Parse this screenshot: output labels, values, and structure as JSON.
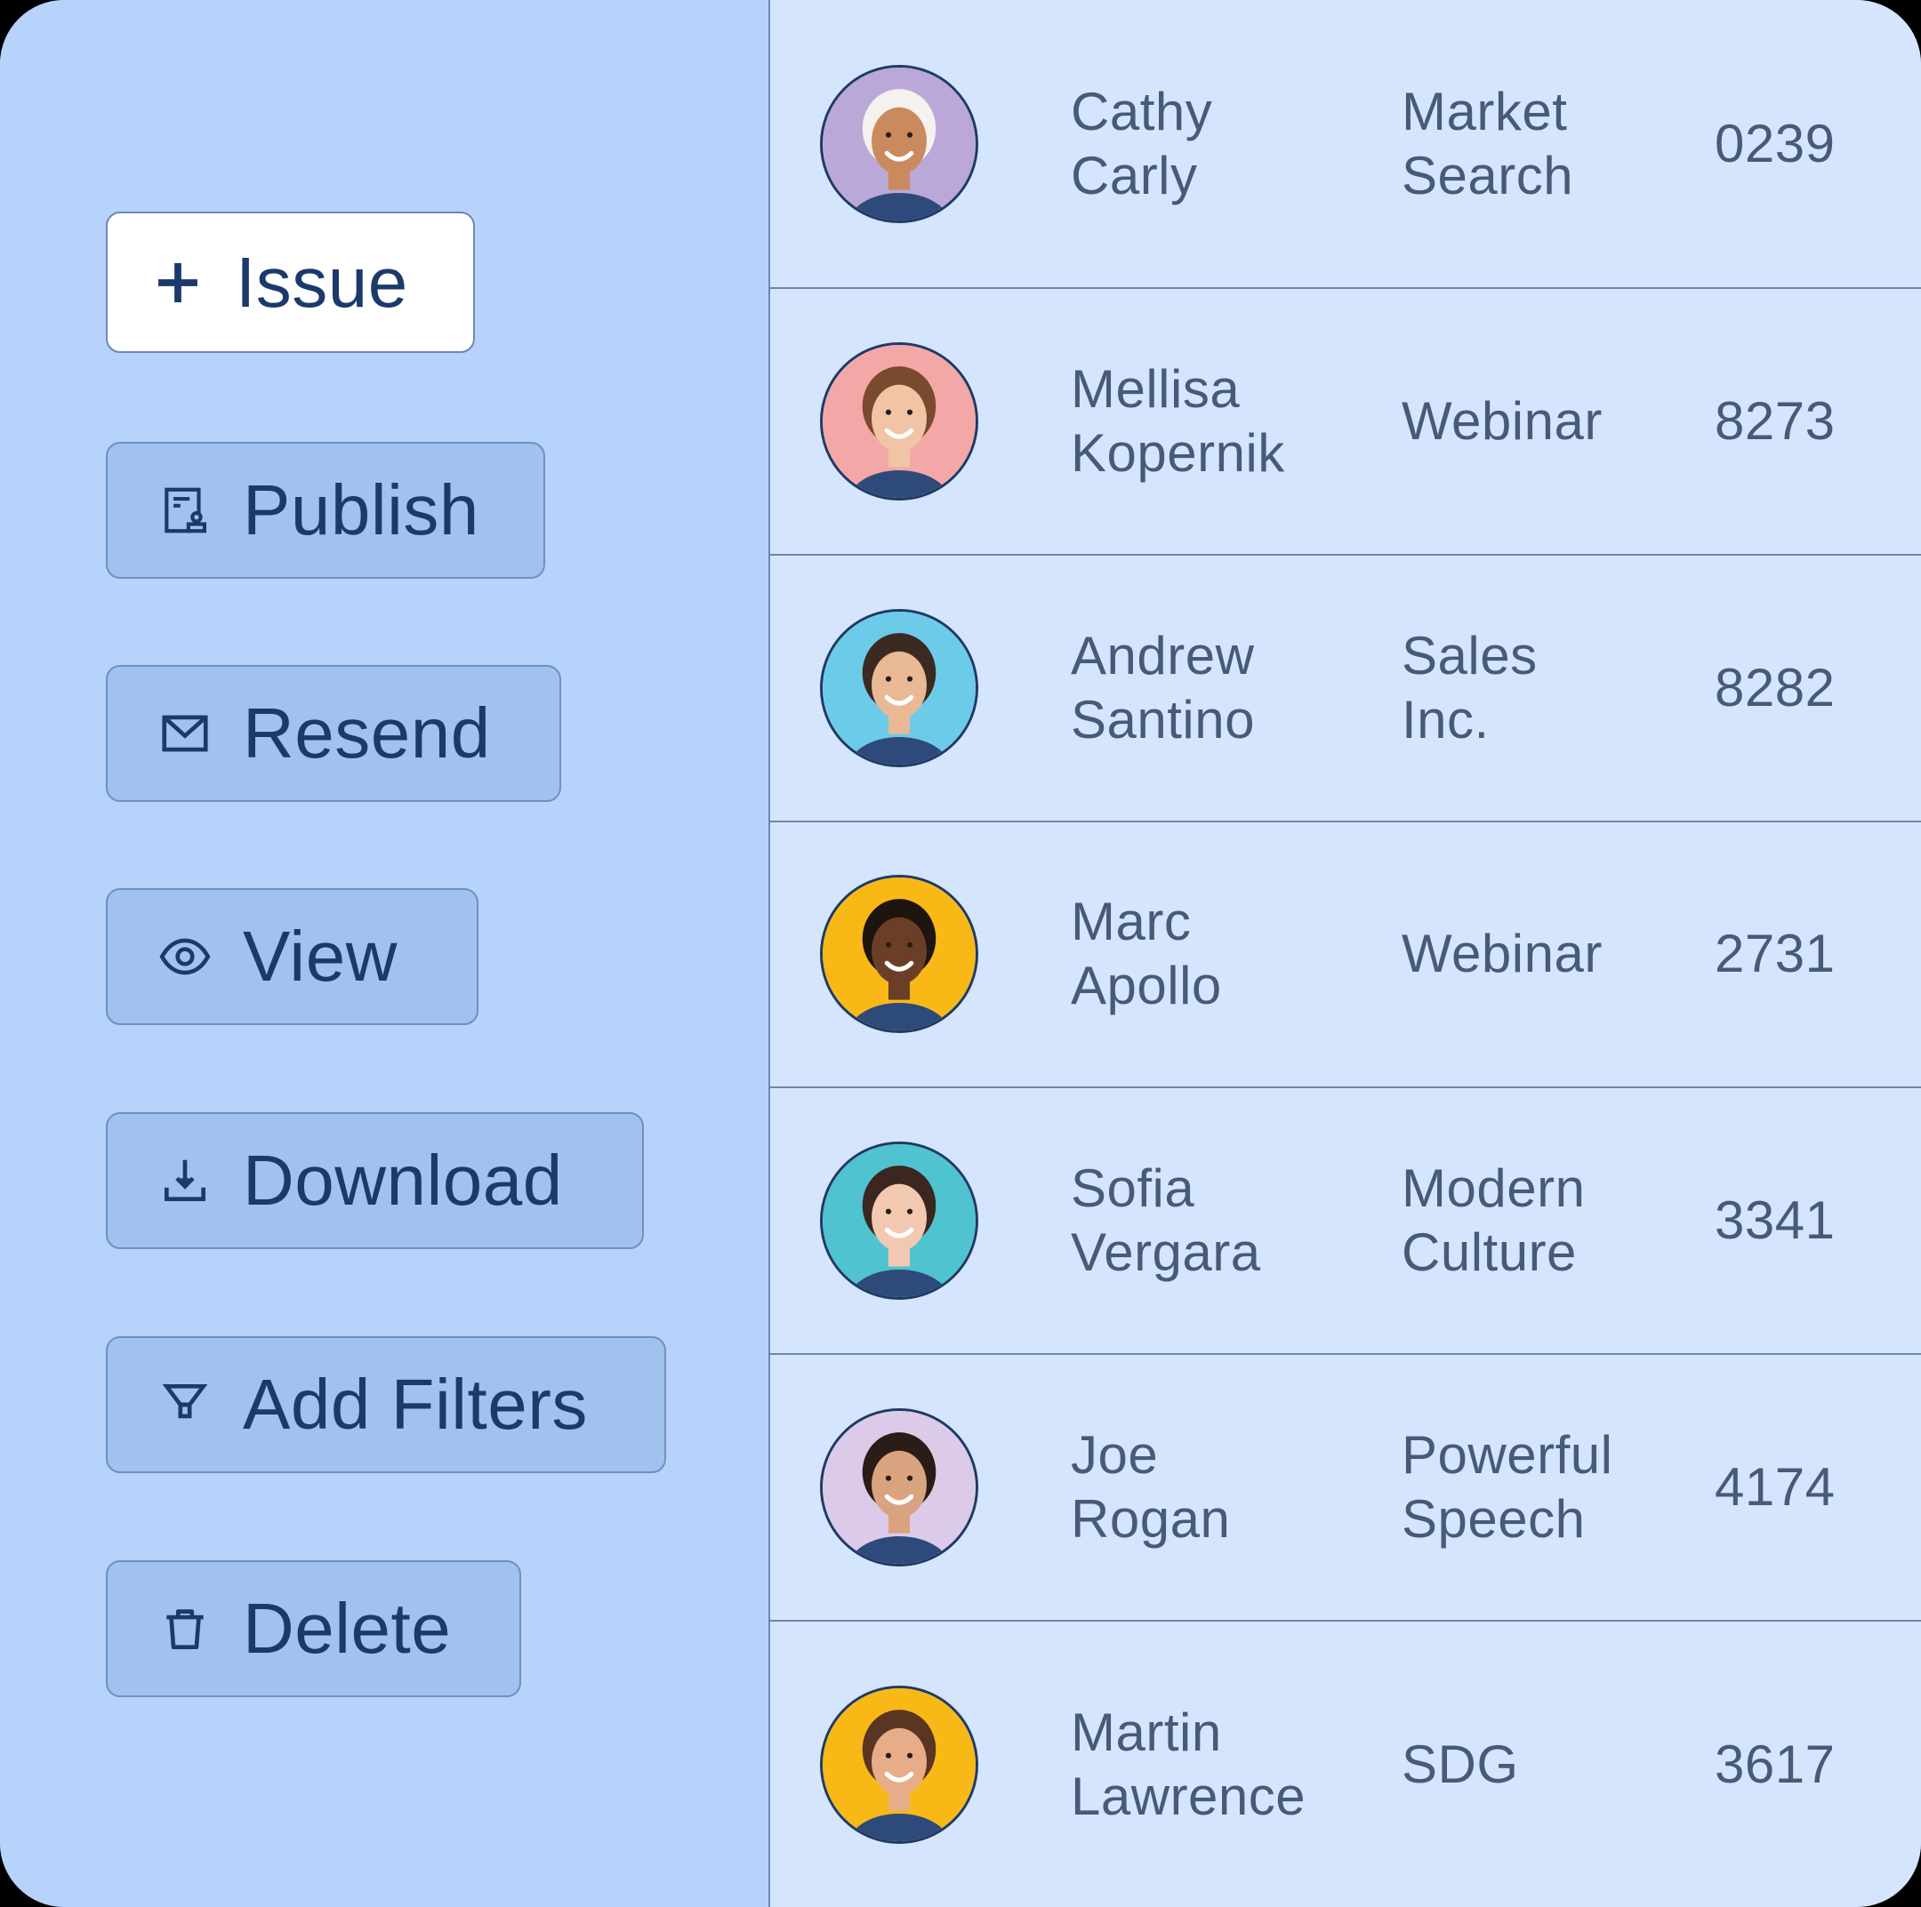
{
  "actions": [
    {
      "id": "issue",
      "label": "Issue",
      "icon": "plus-icon",
      "style": "primary"
    },
    {
      "id": "publish",
      "label": "Publish",
      "icon": "publish-document-icon",
      "style": "secondary"
    },
    {
      "id": "resend",
      "label": "Resend",
      "icon": "mail-icon",
      "style": "secondary"
    },
    {
      "id": "view",
      "label": "View",
      "icon": "eye-icon",
      "style": "secondary"
    },
    {
      "id": "download",
      "label": "Download",
      "icon": "download-icon",
      "style": "secondary"
    },
    {
      "id": "add-filters",
      "label": "Add Filters",
      "icon": "filter-icon",
      "style": "secondary"
    },
    {
      "id": "delete",
      "label": "Delete",
      "icon": "trash-icon",
      "style": "secondary"
    }
  ],
  "rows": [
    {
      "first": "Cathy",
      "last": "Carly",
      "event1": "Market",
      "event2": "Search",
      "code": "0239",
      "avatar_bg": "#b9a8d8",
      "skin": "#c98a5e",
      "hair": "#f4f1ee"
    },
    {
      "first": "Mellisa",
      "last": "Kopernik",
      "event1": "Webinar",
      "event2": "",
      "code": "8273",
      "avatar_bg": "#f4a7a7",
      "skin": "#f0c4a4",
      "hair": "#7a4a2e"
    },
    {
      "first": "Andrew",
      "last": "Santino",
      "event1": "Sales",
      "event2": "Inc.",
      "code": "8282",
      "avatar_bg": "#6ccbe8",
      "skin": "#e9b894",
      "hair": "#3a2a22"
    },
    {
      "first": "Marc",
      "last": "Apollo",
      "event1": "Webinar",
      "event2": "",
      "code": "2731",
      "avatar_bg": "#f8b916",
      "skin": "#6b3f27",
      "hair": "#1e1410"
    },
    {
      "first": "Sofia",
      "last": "Vergara",
      "event1": "Modern",
      "event2": "Culture",
      "code": "3341",
      "avatar_bg": "#4fc3cf",
      "skin": "#f2c9b0",
      "hair": "#3b2620"
    },
    {
      "first": "Joe",
      "last": "Rogan",
      "event1": "Powerful",
      "event2": "Speech",
      "code": "4174",
      "avatar_bg": "#dccbe8",
      "skin": "#d9a37f",
      "hair": "#2a1c16"
    },
    {
      "first": "Martin",
      "last": "Lawrence",
      "event1": "SDG",
      "event2": "",
      "code": "3617",
      "avatar_bg": "#f8b916",
      "skin": "#e6ad88",
      "hair": "#5a3522"
    }
  ],
  "colors": {
    "left_panel": "#b7d3fc",
    "right_panel": "#d5e5fe",
    "button_bg": "#a1c1ef",
    "button_text": "#1b3a6b",
    "table_text": "#475a78",
    "divider": "#6d86ac"
  }
}
